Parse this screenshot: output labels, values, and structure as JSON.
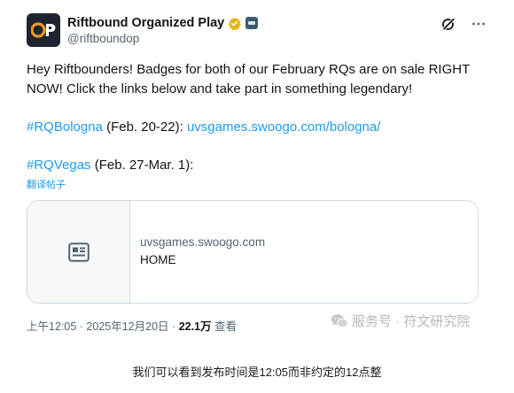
{
  "post": {
    "display_name": "Riftbound Organized Play",
    "handle": "@riftboundop",
    "verified_badge": "gold-check",
    "affiliate_badge": "affiliate-logo",
    "avatar_text": "OP",
    "text": {
      "line1": "Hey Riftbounders! Badges for both of our February RQs are on sale RIGHT NOW! Click the links below and take part in something legendary!",
      "bologna_tag": "#RQBologna",
      "bologna_dates": " (Feb. 20-22): ",
      "bologna_link": "uvsgames.swoogo.com/bologna/",
      "vegas_tag": "#RQVegas",
      "vegas_dates": " (Feb. 27-Mar. 1):"
    },
    "translate_label": "翻译帖子",
    "card": {
      "domain": "uvsgames.swoogo.com",
      "title": "HOME",
      "icon": "article-icon"
    },
    "meta": {
      "time": "上午12:05",
      "date": "2025年12月20日",
      "separator": "·",
      "views_count": "22.1万",
      "views_label": "查看"
    }
  },
  "watermark": {
    "text": "服务号 · 符文研究院",
    "icon": "wechat-icon"
  },
  "caption": "我们可以看到发布时间是12:05而非约定的12点整",
  "colors": {
    "link": "#1d9bf0",
    "secondary_text": "#536471",
    "primary_text": "#0f1419",
    "border": "#cfd9de",
    "verified_gold": "#e2b719",
    "avatar_orange": "#f39a1e"
  }
}
